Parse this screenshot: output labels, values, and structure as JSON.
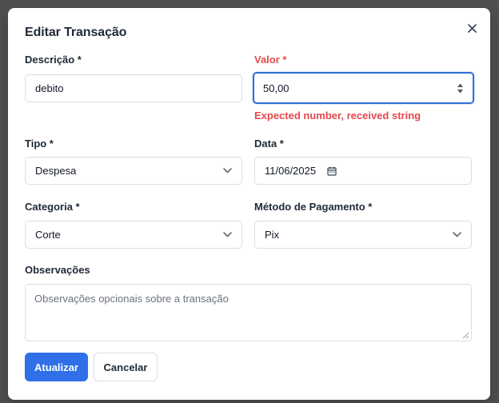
{
  "dialog": {
    "title": "Editar Transação"
  },
  "fields": {
    "descricao": {
      "label": "Descrição *",
      "value": "debito"
    },
    "valor": {
      "label": "Valor *",
      "value": "50,00",
      "error": "Expected number, received string"
    },
    "tipo": {
      "label": "Tipo *",
      "value": "Despesa"
    },
    "data": {
      "label": "Data *",
      "value": "11/06/2025"
    },
    "categoria": {
      "label": "Categoria *",
      "value": "Corte"
    },
    "metodo": {
      "label": "Método de Pagamento *",
      "value": "Pix"
    },
    "observacoes": {
      "label": "Observações",
      "placeholder": "Observações opcionais sobre a transação"
    }
  },
  "buttons": {
    "submit": "Atualizar",
    "cancel": "Cancelar"
  },
  "icons": {
    "close": "close-icon",
    "stepper": "spinner-arrows-icon",
    "calendar": "calendar-icon",
    "chevron": "chevron-down-icon"
  },
  "colors": {
    "primary": "#2f6fe8",
    "error": "#e5484d",
    "focus": "#2f6fd8"
  }
}
